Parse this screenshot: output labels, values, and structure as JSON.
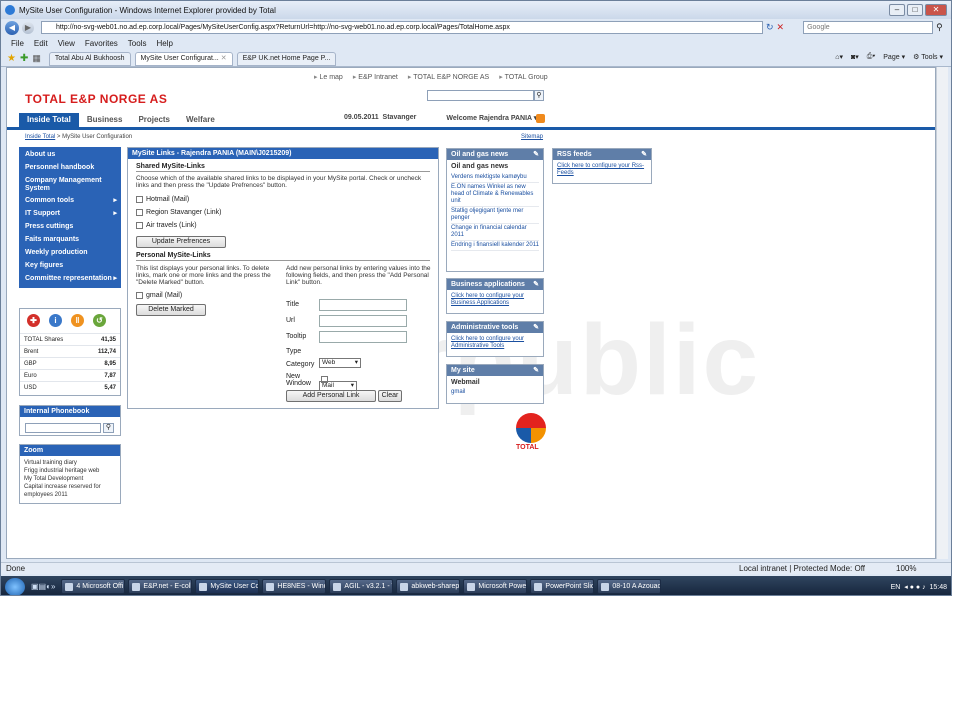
{
  "browser": {
    "title": "MySite User Configuration - Windows Internet Explorer provided by Total",
    "url": "http://no-svg-web01.no.ad.ep.corp.local/Pages/MySiteUserConfig.aspx?ReturnUrl=http://no-svg-web01.no.ad.ep.corp.local/Pages/TotalHome.aspx",
    "search_placeholder": "Google",
    "menu": [
      "File",
      "Edit",
      "View",
      "Favorites",
      "Tools",
      "Help"
    ],
    "tabs": [
      "Total Abu Al Bukhoosh",
      "MySite User Configurat...",
      "E&P UK.net Home Page P..."
    ],
    "commands": [
      "Page",
      "Tools"
    ],
    "status_left": "Done",
    "status_zone": "Local intranet | Protected Mode: Off",
    "status_zoom": "100%"
  },
  "taskbar": {
    "items": [
      "4 Microsoft Offi...",
      "E&P.net - E-colla...",
      "MySite User Confi...",
      "HE8NES - Windo...",
      "AGIL - v3.2.1 - Wi...",
      "abkweb-sharepoint",
      "Microsoft PowerP...",
      "PowerPoint Slide ...",
      "08-10 A Azouaou ..."
    ],
    "lang": "EN",
    "time": "15:48"
  },
  "page": {
    "top_links": [
      "Le map",
      "E&P Intranet",
      "TOTAL E&P NORGE AS",
      "TOTAL Group"
    ],
    "logo": "TOTAL E&P NORGE AS",
    "nav_tabs": [
      "Inside Total",
      "Business",
      "Projects",
      "Welfare"
    ],
    "date": "09.05.2011",
    "location": "Stavanger",
    "welcome": "Welcome Rajendra PANIA ▾",
    "breadcrumb_link": "Inside Total",
    "breadcrumb_rest": " > MySite User Configuration",
    "sitemap": "Sitemap",
    "watermark": "interpublic",
    "total_text": "TOTAL"
  },
  "leftnav": [
    {
      "label": "About us",
      "arrow": false
    },
    {
      "label": "Personnel handbook",
      "arrow": false
    },
    {
      "label": "Company Management System",
      "arrow": false
    },
    {
      "label": "Common tools",
      "arrow": true
    },
    {
      "label": "IT Support",
      "arrow": true
    },
    {
      "label": "Press cuttings",
      "arrow": false
    },
    {
      "label": "Faits marquants",
      "arrow": false
    },
    {
      "label": "Weekly production",
      "arrow": false
    },
    {
      "label": "Key figures",
      "arrow": false
    },
    {
      "label": "Committee representation",
      "arrow": true
    }
  ],
  "quotes": [
    {
      "label": "TOTAL Shares",
      "value": "41,35"
    },
    {
      "label": "Brent",
      "value": "112,74"
    },
    {
      "label": "GBP",
      "value": "8,95"
    },
    {
      "label": "Euro",
      "value": "7,87"
    },
    {
      "label": "USD",
      "value": "5,47"
    }
  ],
  "phonebook": {
    "title": "Internal Phonebook"
  },
  "zoom": {
    "title": "Zoom",
    "items": [
      "Virtual training diary",
      "Frigg industrial heritage web",
      "My Total Development",
      "Capital increase reserved for employees 2011"
    ]
  },
  "mysite": {
    "header": "MySite Links - Rajendra PANIA (MAIN\\J0215209)",
    "shared_title": "Shared MySite-Links",
    "shared_desc": "Choose which of the available shared links to be displayed in your MySite portal. Check or uncheck links and then press the \"Update Prefrences\" button.",
    "shared_links": [
      "Hotmail (Mail)",
      "Region Stavanger (Link)",
      "Air travels (Link)"
    ],
    "update_btn": "Update Prefrences",
    "personal_title": "Personal MySite-Links",
    "personal_desc": "This list displays your personal links. To delete links, mark one or more links and the press the \"Delete Marked\" button.",
    "personal_links": [
      "gmail (Mail)"
    ],
    "delete_btn": "Delete Marked",
    "add_desc": "Add new personal links by entering values into the following fields, and then press the \"Add Personal Link\" button.",
    "fields": {
      "title": "Title",
      "url": "Url",
      "tooltip": "Tooltip",
      "type": "Type",
      "category": "Category",
      "new_window": "New Window"
    },
    "type_value": "Web",
    "category_value": "Mail",
    "add_btn": "Add Personal Link",
    "clear_btn": "Clear"
  },
  "news": {
    "header": "Oil and gas news",
    "subheader": "Oil and gas news",
    "items": [
      "Verdens mektigste kamøybu",
      "E.ON names Winkel as new head of Climate & Renewables unit",
      "Statlig oljegigant tjente mer penger",
      "Change in financial calendar 2011",
      "Endring i finansiell kalender 2011"
    ]
  },
  "business_apps": {
    "header": "Business applications",
    "link": "Click here to configure your Business Applications"
  },
  "admin_tools": {
    "header": "Administrative tools",
    "link": "Click here to configure your Administrative Tools"
  },
  "mysite_box": {
    "header": "My site",
    "subheader": "Webmail",
    "link": "gmail"
  },
  "rss": {
    "header": "RSS feeds",
    "link": "Click here to configure your Rss-Feeds"
  }
}
